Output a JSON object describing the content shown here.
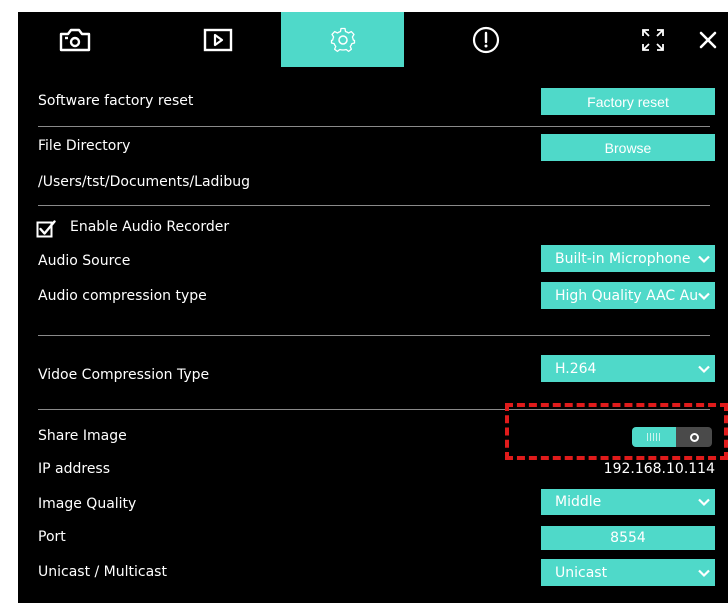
{
  "tabs": [
    {
      "id": "camera",
      "icon": "camera-icon",
      "active": false
    },
    {
      "id": "playback",
      "icon": "play-icon",
      "active": false
    },
    {
      "id": "settings",
      "icon": "gear-icon",
      "active": true
    },
    {
      "id": "info",
      "icon": "alert-icon",
      "active": false
    }
  ],
  "colors": {
    "accent": "#4fd9c9",
    "background": "#000000",
    "divider": "#8a8a8a",
    "highlight": "#e01b1b"
  },
  "factory_reset": {
    "label": "Software factory reset",
    "button": "Factory reset"
  },
  "file_directory": {
    "label": "File Directory",
    "button": "Browse",
    "path": "/Users/tst/Documents/Ladibug"
  },
  "audio": {
    "enable_label": "Enable Audio Recorder",
    "enabled": true,
    "source_label": "Audio Source",
    "source_value": "Built-in Microphone",
    "compression_label": "Audio compression type",
    "compression_value": "High Quality AAC Au"
  },
  "video": {
    "compression_label": "Vidoe Compression Type",
    "compression_value": "H.264"
  },
  "share": {
    "share_label": "Share Image",
    "share_enabled": true,
    "ip_label": "IP address",
    "ip_value": "192.168.10.114",
    "quality_label": "Image Quality",
    "quality_value": "Middle",
    "port_label": "Port",
    "port_value": "8554",
    "cast_label": "Unicast / Multicast",
    "cast_value": "Unicast"
  }
}
